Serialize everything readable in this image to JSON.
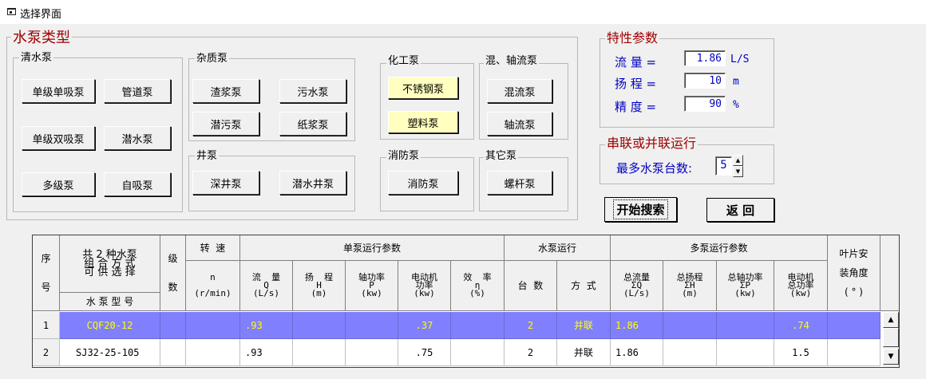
{
  "window": {
    "title": "选择界面"
  },
  "pump_type": {
    "title": "水泵类型",
    "clean_water": {
      "label": "清水泵",
      "buttons": [
        "单级单吸泵",
        "管道泵",
        "单级双吸泵",
        "潜水泵",
        "多级泵",
        "自吸泵"
      ]
    },
    "impurity": {
      "label": "杂质泵",
      "buttons": [
        "渣浆泵",
        "污水泵",
        "潜污泵",
        "纸浆泵"
      ]
    },
    "well": {
      "label": "井泵",
      "buttons": [
        "深井泵",
        "潜水井泵"
      ]
    },
    "chemical": {
      "label": "化工泵",
      "buttons": [
        "不锈钢泵",
        "塑料泵"
      ]
    },
    "mixed_axial": {
      "label": "混、轴流泵",
      "buttons": [
        "混流泵",
        "轴流泵"
      ]
    },
    "fire": {
      "label": "消防泵",
      "buttons": [
        "消防泵"
      ]
    },
    "other": {
      "label": "其它泵",
      "buttons": [
        "螺杆泵"
      ]
    }
  },
  "params": {
    "title": "特性参数",
    "flow": {
      "label": "流  量 =",
      "value": "1.86",
      "unit": "L/S"
    },
    "head": {
      "label": "扬  程 =",
      "value": "10",
      "unit": "m"
    },
    "accuracy": {
      "label": "精  度 =",
      "value": "90",
      "unit": "%"
    }
  },
  "series": {
    "title": "串联或并联运行",
    "max_label": "最多水泵台数:",
    "max_value": "5"
  },
  "actions": {
    "search": "开始搜索",
    "back": "返  回"
  },
  "table": {
    "headers": {
      "seq": "序\n\n\n号",
      "combo_top": "共 2 种水泵\n组 合 方 式\n可 供 选 择",
      "model": "水 泵 型 号",
      "stages": "级\n\n\n数",
      "speed_top": "转  速",
      "speed_sub": "n\n\n(r/min)",
      "single_group": "单泵运行参数",
      "flow": "流  量\nQ\n(L/s)",
      "head": "扬  程\nH\n(m)",
      "shaft": "轴功率\nP\n(kw)",
      "motor": "电动机\n功率\n(kw)",
      "eff": "效  率\nη\n(%)",
      "pump_run_group": "水泵运行",
      "count": "台  数",
      "mode": "方  式",
      "multi_group": "多泵运行参数",
      "total_flow": "总流量\nΣQ\n(L/s)",
      "total_head": "总扬程\nΣH\n(m)",
      "total_shaft": "总轴功率\nΣP\n(kw)",
      "total_motor": "电动机\n总功率\n(kw)",
      "blade": "叶片安\n\n装角度\n\n( ° )"
    },
    "rows": [
      {
        "no": "1",
        "model": "CQF20-12",
        "stages": "",
        "speed": "",
        "flow": ".93",
        "head": "",
        "shaft": "",
        "motor": ".37",
        "eff": "",
        "count": "2",
        "mode": "并联",
        "total_flow": "1.86",
        "total_head": "",
        "total_shaft": "",
        "total_motor": ".74",
        "blade": ""
      },
      {
        "no": "2",
        "model": "SJ32-25-105",
        "stages": "",
        "speed": "",
        "flow": ".93",
        "head": "",
        "shaft": "",
        "motor": ".75",
        "eff": "",
        "count": "2",
        "mode": "并联",
        "total_flow": "1.86",
        "total_head": "",
        "total_shaft": "",
        "total_motor": "1.5",
        "blade": ""
      }
    ]
  },
  "colors": {
    "selected_row_bg": "#8080ff",
    "selected_row_fg": "#ffff00",
    "label_blue": "#0000c0",
    "title_red": "#a00000",
    "yellow_button": "#ffffc0"
  },
  "icons": {
    "window_icon": "window-icon",
    "spin_up": "spin-up-icon",
    "spin_down": "spin-down-icon",
    "scroll_up": "scroll-up-icon",
    "scroll_down": "scroll-down-icon"
  }
}
